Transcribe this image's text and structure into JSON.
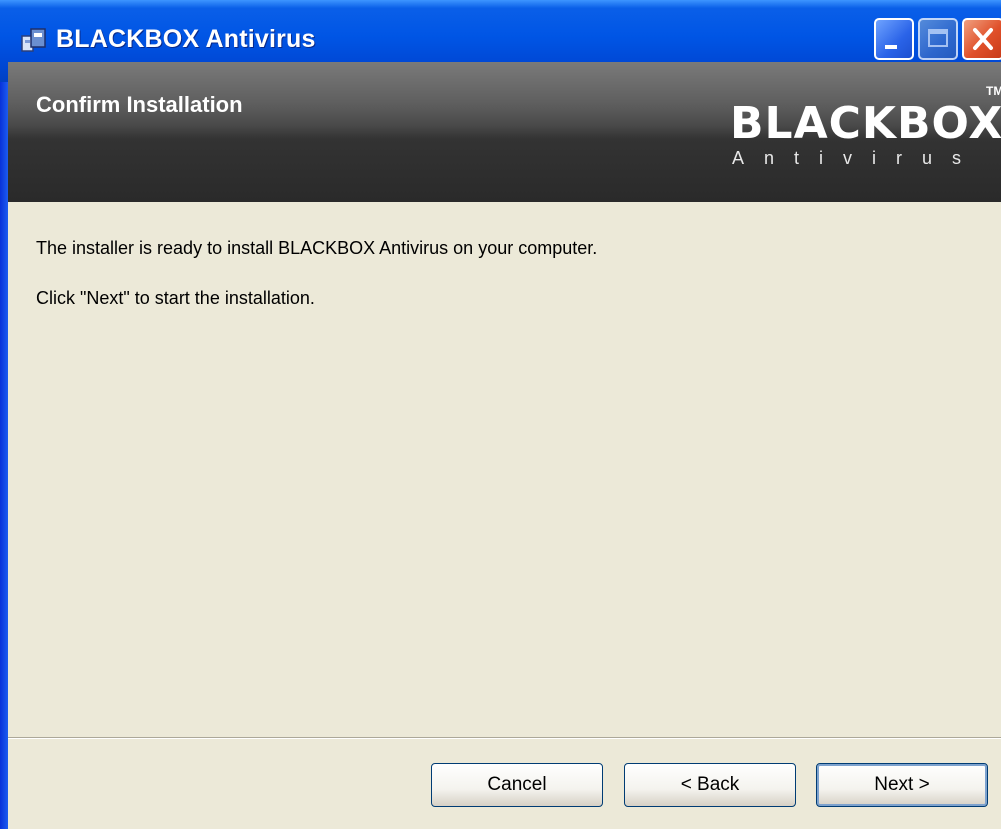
{
  "window": {
    "title": "BLACKBOX Antivirus",
    "controls": [
      "minimize-icon",
      "maximize-icon",
      "close-icon"
    ]
  },
  "banner": {
    "title": "Confirm Installation",
    "brand": "BLACKBOX",
    "brand_tm": "TM",
    "brand_sub": "Antivirus"
  },
  "content": {
    "line1": "The installer is ready to install BLACKBOX Antivirus on your computer.",
    "line2": "Click \"Next\" to start the installation."
  },
  "buttons": {
    "cancel": "Cancel",
    "back": "< Back",
    "next": "Next >"
  },
  "colors": {
    "titlebar": "#0055e5",
    "banner": "#3a3a3a",
    "dialog_bg": "#ece9d8"
  }
}
